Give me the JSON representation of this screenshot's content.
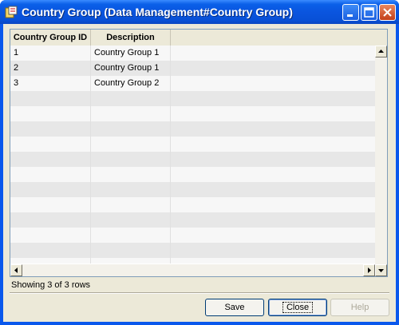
{
  "window": {
    "title": "Country Group (Data Management#Country Group)"
  },
  "grid": {
    "columns": [
      "Country Group ID",
      "Description"
    ],
    "rows": [
      {
        "id": "1",
        "description": "Country Group 1"
      },
      {
        "id": "2",
        "description": "Country Group 1"
      },
      {
        "id": "3",
        "description": "Country Group 2"
      }
    ]
  },
  "status": "Showing 3 of 3 rows",
  "buttons": {
    "save": "Save",
    "close": "Close",
    "help": "Help"
  },
  "icons": {
    "app": "app-icon",
    "minimize": "minimize-icon",
    "maximize": "maximize-icon",
    "close": "close-icon",
    "scroll_up": "arrow-up-icon",
    "scroll_down": "arrow-down-icon",
    "scroll_left": "arrow-left-icon",
    "scroll_right": "arrow-right-icon"
  },
  "colors": {
    "titlebar": "#0a55df",
    "client": "#ece9d8",
    "row_alt": "#e7e7e7",
    "row": "#f7f7f7"
  }
}
